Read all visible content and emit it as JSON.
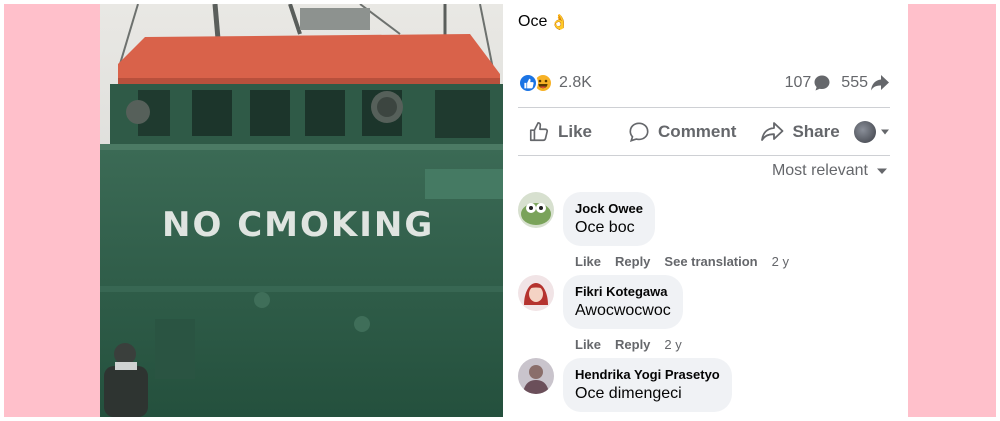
{
  "post": {
    "caption": "Oce",
    "caption_emoji": "👌"
  },
  "photo": {
    "sign_text": "NO CMOKING"
  },
  "stats": {
    "reaction_count": "2.8K",
    "comment_count": "107",
    "share_count": "555"
  },
  "actions": {
    "like_label": "Like",
    "comment_label": "Comment",
    "share_label": "Share"
  },
  "sort": {
    "label": "Most relevant"
  },
  "comments": [
    {
      "name": "Jock Owee",
      "text": "Oce boc",
      "like_label": "Like",
      "reply_label": "Reply",
      "translate_label": "See translation",
      "time": "2 y"
    },
    {
      "name": "Fikri Kotegawa",
      "text": "Awocwocwoc",
      "like_label": "Like",
      "reply_label": "Reply",
      "time": "2 y"
    },
    {
      "name": "Hendrika Yogi Prasetyo",
      "text": "Oce dimengeci"
    }
  ],
  "colors": {
    "frame": "#ffc0cb",
    "like_blue": "#1b74e4",
    "bubble": "#f0f2f5",
    "secondary_text": "#65676b",
    "ship_hull": "#2f5c48",
    "cabin_roof": "#d9624a"
  }
}
